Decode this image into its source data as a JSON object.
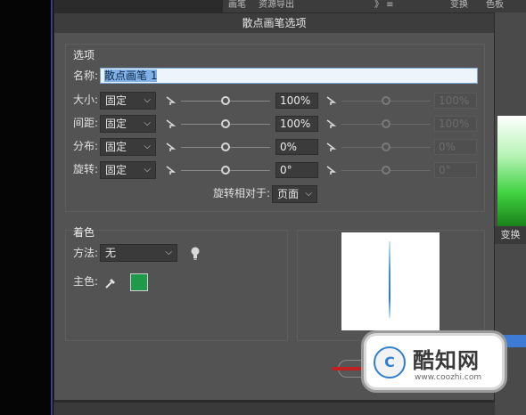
{
  "background": {
    "top_tabs": [
      "画笔",
      "资源导出",
      "》 ≡",
      "变换",
      "色板"
    ],
    "right_panel_tab": "变换"
  },
  "dialog": {
    "title": "散点画笔选项",
    "options_section": {
      "title": "选项",
      "name_label": "名称:",
      "name_value": "散点画笔 1",
      "rows": [
        {
          "label": "大小:",
          "mode": "固定",
          "value": "100%",
          "secondary_value": "100%",
          "slider_fraction": 0.5
        },
        {
          "label": "间距:",
          "mode": "固定",
          "value": "100%",
          "secondary_value": "100%",
          "slider_fraction": 0.5
        },
        {
          "label": "分布:",
          "mode": "固定",
          "value": "0%",
          "secondary_value": "0%",
          "slider_fraction": 0.5
        },
        {
          "label": "旋转:",
          "mode": "固定",
          "value": "0°",
          "secondary_value": "0°",
          "slider_fraction": 0.5
        }
      ],
      "rotation_relative_label": "旋转相对于:",
      "rotation_relative_value": "页面"
    },
    "colorization_section": {
      "title": "着色",
      "method_label": "方法:",
      "method_value": "无",
      "key_color_label": "主色:",
      "key_color": "#1f9a4b"
    }
  },
  "watermark": {
    "logo_char": "C",
    "name": "酷知网",
    "url": "www.coozhi.com"
  },
  "colors": {
    "dialog_bg": "#535353",
    "titlebar_bg": "#3d3d3d",
    "accent_blue": "#3d7bd6"
  }
}
